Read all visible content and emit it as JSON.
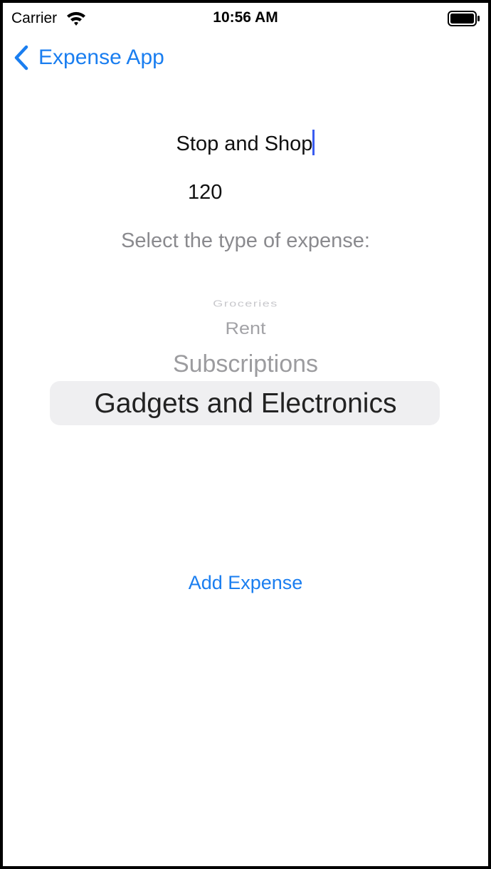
{
  "status_bar": {
    "carrier": "Carrier",
    "time": "10:56 AM"
  },
  "nav": {
    "back_label": "Expense App"
  },
  "form": {
    "name_value": "Stop and Shop",
    "amount_value": "120",
    "type_prompt": "Select the type of expense:"
  },
  "picker": {
    "items": [
      "Groceries",
      "Rent",
      "Subscriptions",
      "Gadgets and Electronics"
    ],
    "selected": "Gadgets and Electronics"
  },
  "actions": {
    "add_label": "Add Expense"
  },
  "colors": {
    "accent": "#1a7ef0",
    "caret": "#3a5cf0",
    "secondary_text": "#8a8a8e"
  }
}
